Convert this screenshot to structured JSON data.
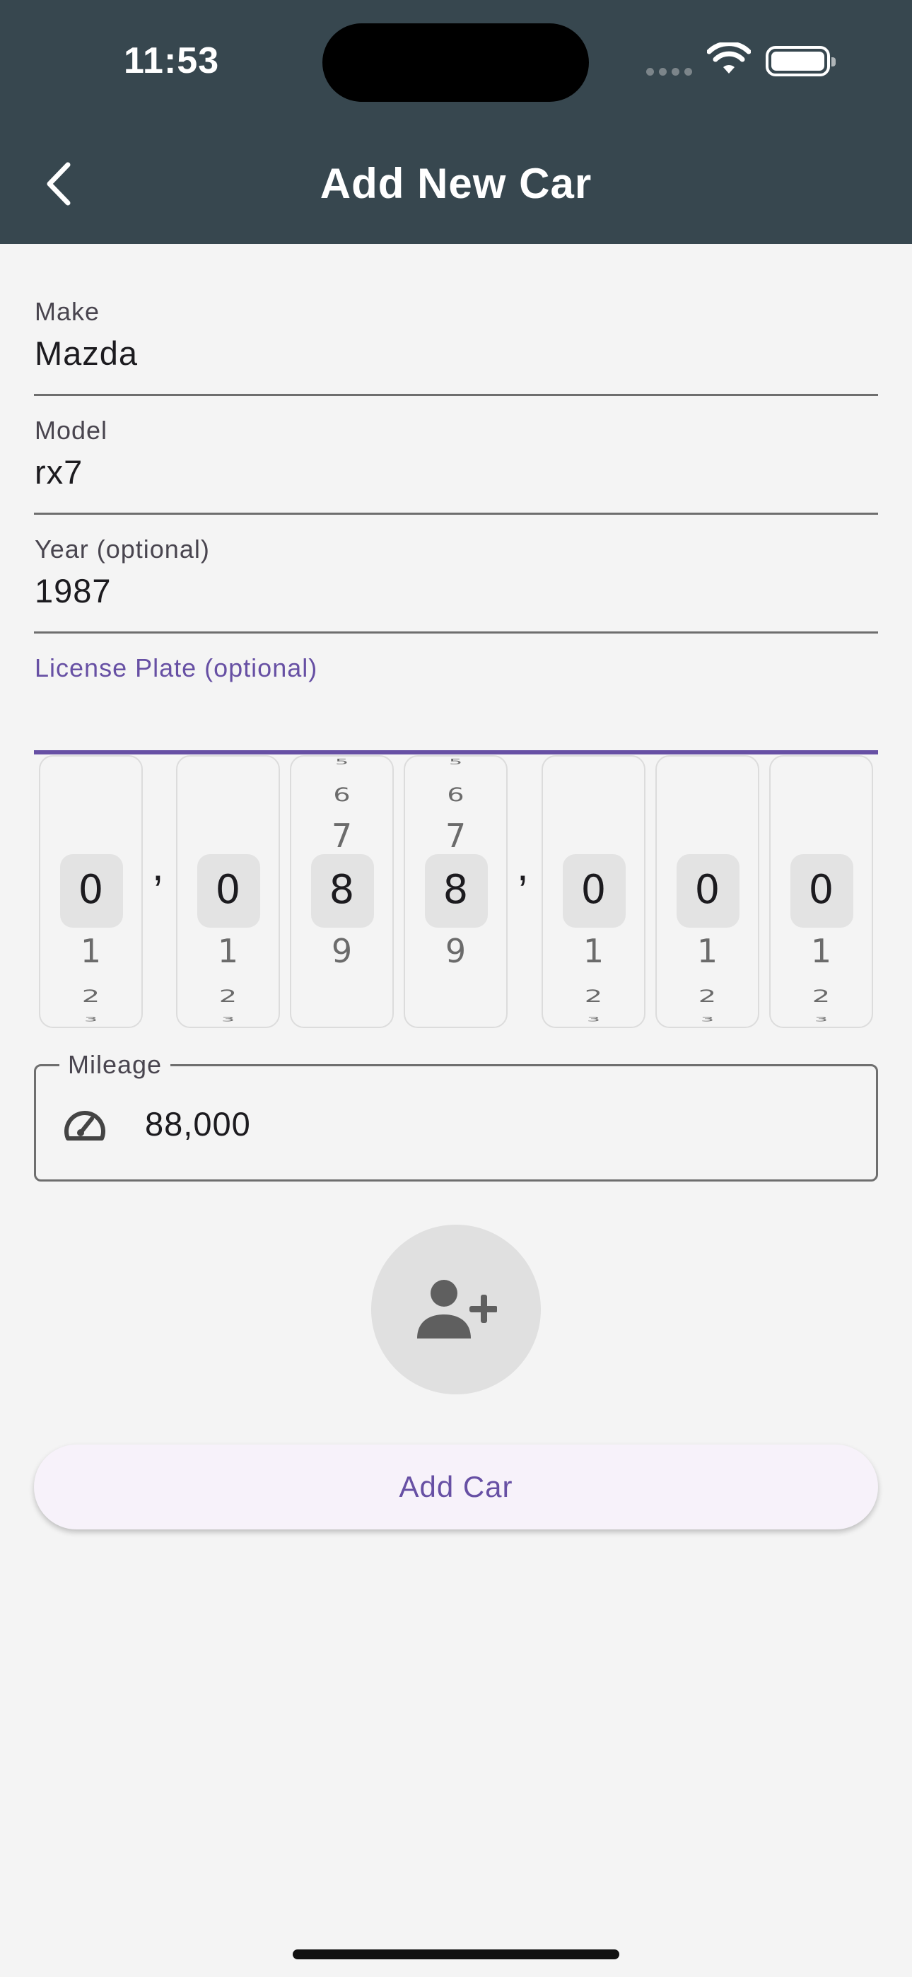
{
  "status_bar": {
    "time": "11:53"
  },
  "appbar": {
    "title": "Add New Car",
    "back_icon": "chevron-left-icon"
  },
  "form": {
    "make": {
      "label": "Make",
      "value": "Mazda"
    },
    "model": {
      "label": "Model",
      "value": "rx7"
    },
    "year": {
      "label": "Year (optional)",
      "value": "1987"
    },
    "license_plate": {
      "label": "License Plate (optional)",
      "value": ""
    }
  },
  "odometer_picker": {
    "separator": ",",
    "wheels": [
      {
        "selected": "0",
        "above": [
          "",
          "",
          ""
        ],
        "below": [
          "1",
          "2",
          "3"
        ]
      },
      {
        "selected": "0",
        "above": [
          "",
          "",
          ""
        ],
        "below": [
          "1",
          "2",
          "3"
        ]
      },
      {
        "selected": "8",
        "above": [
          "7",
          "6",
          "5"
        ],
        "below": [
          "9",
          "",
          ""
        ]
      },
      {
        "selected": "8",
        "above": [
          "7",
          "6",
          "5"
        ],
        "below": [
          "9",
          "",
          ""
        ]
      },
      {
        "selected": "0",
        "above": [
          "",
          "",
          ""
        ],
        "below": [
          "1",
          "2",
          "3"
        ]
      },
      {
        "selected": "0",
        "above": [
          "",
          "",
          ""
        ],
        "below": [
          "1",
          "2",
          "3"
        ]
      },
      {
        "selected": "0",
        "above": [
          "",
          "",
          ""
        ],
        "below": [
          "1",
          "2",
          "3"
        ]
      }
    ]
  },
  "mileage": {
    "label": "Mileage",
    "value": "88,000",
    "icon": "speedometer-icon"
  },
  "add_owner": {
    "icon": "person-add-icon"
  },
  "actions": {
    "add_car_label": "Add Car"
  },
  "colors": {
    "appbar": "#37474f",
    "accent": "#6750a4",
    "background": "#f4f4f4"
  }
}
